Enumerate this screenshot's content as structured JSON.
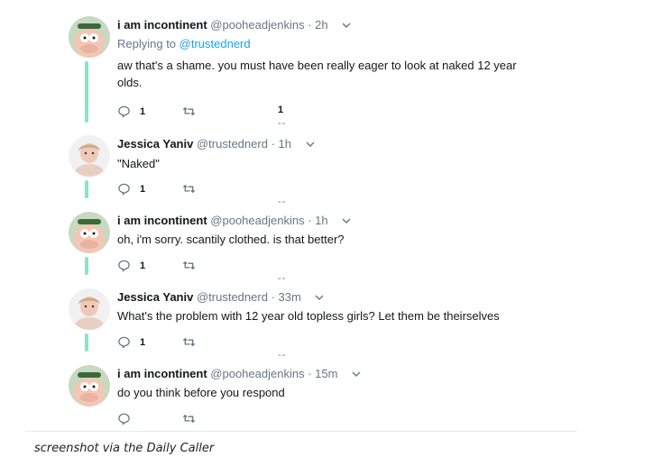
{
  "tweets": [
    {
      "name": "i am incontinent",
      "handle": "@pooheadjenkins",
      "dot": "·",
      "time": "2h",
      "replying_prefix": "Replying to ",
      "replying_to": "@trustednerd",
      "text": "aw that's a shame. you must have been really eager to look at naked 12 year olds.",
      "reply_count": "1",
      "retweet_count": "",
      "like_count": "1",
      "dashes": "--",
      "avatar": "peter-griffin-avatar"
    },
    {
      "name": "Jessica Yaniv",
      "handle": "@trustednerd",
      "dot": "·",
      "time": "1h",
      "text": "\"Naked\"",
      "reply_count": "1",
      "retweet_count": "",
      "dashes": "--",
      "avatar": "jessica-avatar"
    },
    {
      "name": "i am incontinent",
      "handle": "@pooheadjenkins",
      "dot": "·",
      "time": "1h",
      "text": "oh, i'm sorry. scantily clothed. is that better?",
      "reply_count": "1",
      "retweet_count": "",
      "dashes": "--",
      "avatar": "peter-griffin-avatar"
    },
    {
      "name": "Jessica Yaniv",
      "handle": "@trustednerd",
      "dot": "·",
      "time": "33m",
      "text": "What's the problem with 12 year old topless girls? Let them be theirselves",
      "reply_count": "1",
      "retweet_count": "",
      "dashes": "--",
      "avatar": "jessica-avatar"
    },
    {
      "name": "i am incontinent",
      "handle": "@pooheadjenkins",
      "dot": "·",
      "time": "15m",
      "text": "do you think before you respond",
      "reply_count": "",
      "retweet_count": "",
      "avatar": "peter-griffin-avatar"
    }
  ],
  "caption": "screenshot via the Daily Caller",
  "colors": {
    "thread_line": "#8ee2c6",
    "link": "#1da1f2",
    "meta": "#657786",
    "text": "#14171a"
  }
}
